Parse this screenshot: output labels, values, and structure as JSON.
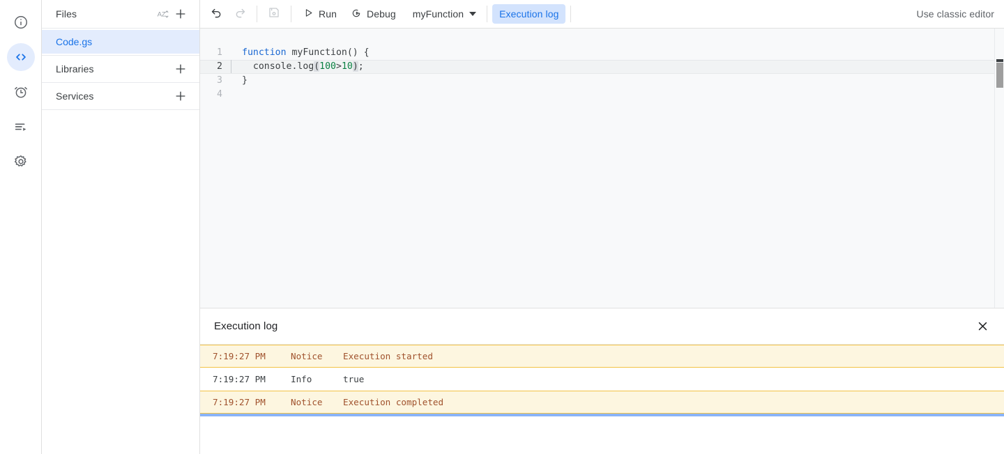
{
  "rail": {
    "items": [
      {
        "name": "overview",
        "icon": "info-circle-icon",
        "active": false
      },
      {
        "name": "editor",
        "icon": "code-brackets-icon",
        "active": true
      },
      {
        "name": "triggers",
        "icon": "alarm-clock-icon",
        "active": false
      },
      {
        "name": "executions",
        "icon": "executions-list-icon",
        "active": false
      },
      {
        "name": "settings",
        "icon": "gear-icon",
        "active": false
      }
    ]
  },
  "sidebar": {
    "files_header": "Files",
    "sort_icon": "sort-az-icon",
    "add_file_icon": "plus-icon",
    "files": [
      {
        "name": "Code.gs",
        "selected": true
      }
    ],
    "sections": [
      {
        "label": "Libraries",
        "add_icon": "plus-icon"
      },
      {
        "label": "Services",
        "add_icon": "plus-icon"
      }
    ]
  },
  "toolbar": {
    "undo_icon": "undo-icon",
    "redo_icon": "redo-icon",
    "save_icon": "save-icon",
    "run_label": "Run",
    "run_icon": "play-triangle-icon",
    "debug_label": "Debug",
    "debug_icon": "debug-bug-icon",
    "function_selected": "myFunction",
    "function_caret_icon": "caret-down-icon",
    "execution_log_tab": "Execution log",
    "classic_editor_link": "Use classic editor"
  },
  "editor": {
    "active_line": 2,
    "lines": [
      {
        "n": "1",
        "tokens": [
          {
            "t": "function",
            "c": "kw"
          },
          {
            "t": " myFunction() {",
            "c": ""
          }
        ]
      },
      {
        "n": "2",
        "tokens": [
          {
            "t": "  console.log",
            "c": ""
          },
          {
            "t": "(",
            "c": "brk"
          },
          {
            "t": "100",
            "c": "num"
          },
          {
            "t": ">",
            "c": ""
          },
          {
            "t": "10",
            "c": "num"
          },
          {
            "t": ")",
            "c": "brk"
          },
          {
            "t": ";",
            "c": ""
          }
        ]
      },
      {
        "n": "3",
        "tokens": [
          {
            "t": "}",
            "c": ""
          }
        ]
      },
      {
        "n": "4",
        "tokens": [
          {
            "t": "",
            "c": ""
          }
        ]
      }
    ]
  },
  "log": {
    "title": "Execution log",
    "close_icon": "close-x-icon",
    "rows": [
      {
        "time": "7:19:27 PM",
        "level": "Notice",
        "message": "Execution started",
        "kind": "notice"
      },
      {
        "time": "7:19:27 PM",
        "level": "Info",
        "message": "true",
        "kind": "info"
      },
      {
        "time": "7:19:27 PM",
        "level": "Notice",
        "message": "Execution completed",
        "kind": "notice"
      }
    ]
  },
  "colors": {
    "accent_blue": "#1a73e8",
    "tab_bg": "#d3e3fd",
    "notice_bg": "#fdf6e0",
    "notice_border": "#f3c244",
    "notice_text": "#a0522d",
    "progress_blue": "#8ab4f8",
    "keyword": "#1967d2",
    "number": "#0b8043"
  }
}
